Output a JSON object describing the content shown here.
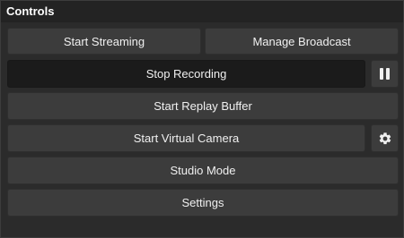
{
  "dock": {
    "title": "Controls"
  },
  "buttons": {
    "start_streaming": "Start Streaming",
    "manage_broadcast": "Manage Broadcast",
    "stop_recording": "Stop Recording",
    "start_replay_buffer": "Start Replay Buffer",
    "start_virtual_camera": "Start Virtual Camera",
    "studio_mode": "Studio Mode",
    "settings": "Settings"
  },
  "icons": {
    "pause": "pause-icon",
    "virtual_camera_config": "gear-icon"
  },
  "colors": {
    "panel_bg": "#2b2b2b",
    "title_bg": "#232323",
    "button_bg": "#3c3c3c",
    "active_button_bg": "#1b1b1b",
    "text": "#f0f0f0"
  }
}
